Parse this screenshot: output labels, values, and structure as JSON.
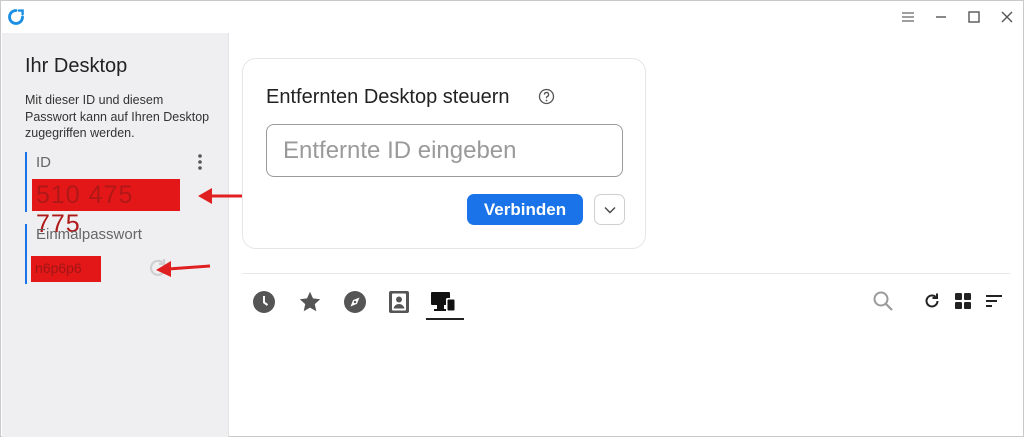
{
  "window": {
    "logo_icon": "rustdesk-logo-icon",
    "controls": [
      "menu-icon",
      "minimize-icon",
      "maximize-icon",
      "close-icon"
    ]
  },
  "sidebar": {
    "title": "Ihr Desktop",
    "description": "Mit dieser ID und diesem Passwort kann auf Ihren Desktop zugegriffen werden.",
    "id_label": "ID",
    "id_value": "510 475 775",
    "password_label": "Einmalpasswort",
    "password_value": "n6p6p6"
  },
  "connect_card": {
    "title": "Entfernten Desktop steuern",
    "input_placeholder": "Entfernte ID eingeben",
    "input_value": "",
    "connect_label": "Verbinden"
  },
  "tabs": [
    {
      "name": "recent-sessions",
      "icon": "clock-icon"
    },
    {
      "name": "favorites",
      "icon": "star-icon"
    },
    {
      "name": "discovered",
      "icon": "compass-icon"
    },
    {
      "name": "address-book",
      "icon": "contact-book-icon"
    },
    {
      "name": "accessible-devices",
      "icon": "devices-icon",
      "active": true
    }
  ],
  "toolbar_icons": [
    "search-icon",
    "refresh-icon",
    "grid-view-icon",
    "sort-icon"
  ],
  "colors": {
    "accent": "#1a73e8",
    "redaction": "#e31717",
    "annotation_arrow": "#e02020",
    "sidebar_bg": "#efeff1"
  }
}
